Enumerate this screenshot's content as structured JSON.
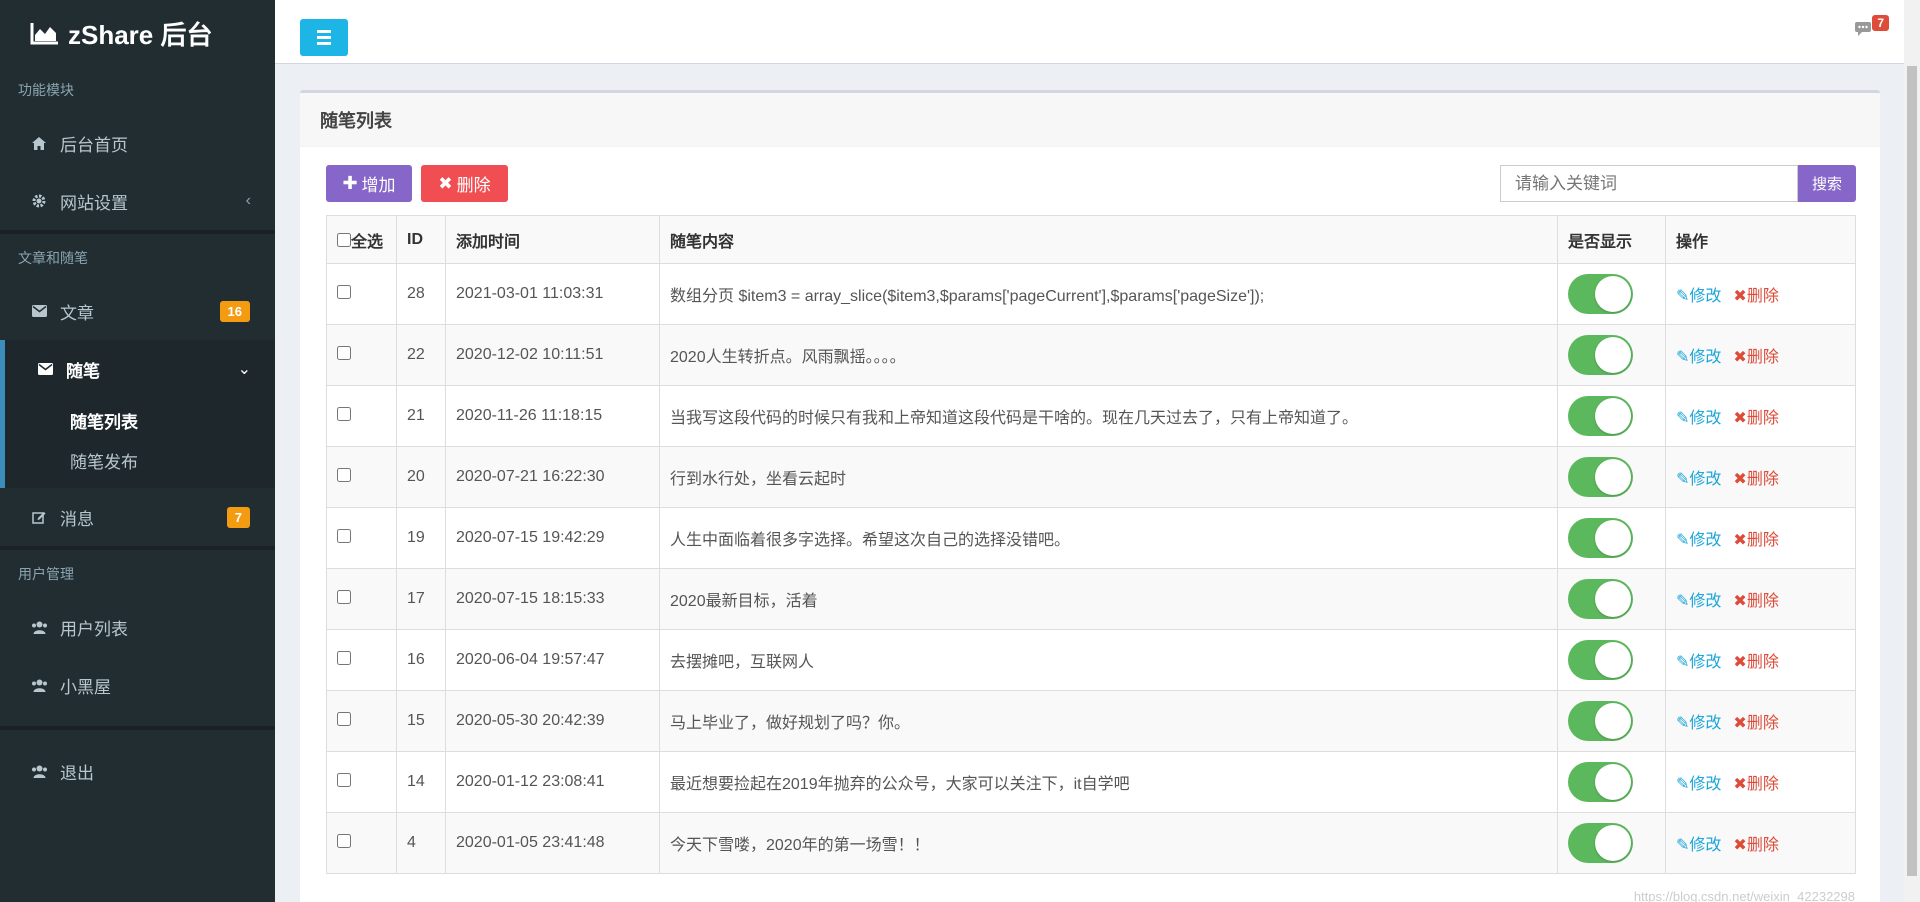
{
  "app": {
    "logo_text": "zShare 后台"
  },
  "sidebar": {
    "sections": [
      {
        "label": "功能模块"
      },
      {
        "label": "文章和随笔"
      },
      {
        "label": "用户管理"
      }
    ],
    "items": {
      "home": "后台首页",
      "settings": "网站设置",
      "articles": "文章",
      "articles_badge": "16",
      "notes": "随笔",
      "notes_list": "随笔列表",
      "notes_publish": "随笔发布",
      "messages": "消息",
      "messages_badge": "7",
      "users": "用户列表",
      "blackroom": "小黑屋",
      "logout": "退出"
    }
  },
  "header": {
    "message_count": "7"
  },
  "main": {
    "title": "随笔列表",
    "add_label": "增加",
    "delete_label": "删除",
    "search_placeholder": "请输入关键词",
    "search_label": "搜索",
    "columns": {
      "select_all": "全选",
      "id": "ID",
      "time": "添加时间",
      "content": "随笔内容",
      "visible": "是否显示",
      "actions": "操作"
    },
    "edit_label": "修改",
    "row_delete_label": "删除",
    "rows": [
      {
        "id": "28",
        "time": "2021-03-01 11:03:31",
        "content": "数组分页 $item3 = array_slice($item3,$params['pageCurrent'],$params['pageSize']);",
        "visible": true
      },
      {
        "id": "22",
        "time": "2020-12-02 10:11:51",
        "content": "2020人生转折点。风雨飘摇。。。。",
        "visible": true
      },
      {
        "id": "21",
        "time": "2020-11-26 11:18:15",
        "content": "当我写这段代码的时候只有我和上帝知道这段代码是干啥的。现在几天过去了，只有上帝知道了。",
        "visible": true
      },
      {
        "id": "20",
        "time": "2020-07-21 16:22:30",
        "content": "行到水行处，坐看云起时",
        "visible": true
      },
      {
        "id": "19",
        "time": "2020-07-15 19:42:29",
        "content": "人生中面临着很多字选择。希望这次自己的选择没错吧。",
        "visible": true
      },
      {
        "id": "17",
        "time": "2020-07-15 18:15:33",
        "content": "2020最新目标，活着",
        "visible": true
      },
      {
        "id": "16",
        "time": "2020-06-04 19:57:47",
        "content": "去摆摊吧，互联网人",
        "visible": true
      },
      {
        "id": "15",
        "time": "2020-05-30 20:42:39",
        "content": "马上毕业了，做好规划了吗？你。",
        "visible": true
      },
      {
        "id": "14",
        "time": "2020-01-12 23:08:41",
        "content": "最近想要捡起在2019年抛弃的公众号，大家可以关注下，it自学吧",
        "visible": true
      },
      {
        "id": "4",
        "time": "2020-01-05 23:41:48",
        "content": "今天下雪喽，2020年的第一场雪！！",
        "visible": true
      }
    ]
  },
  "watermark": "https://blog.csdn.net/weixin_42232298",
  "colors": {
    "sidebar_bg": "#222d32",
    "accent_purple": "#8667c9",
    "danger": "#f04e52",
    "toggle_on": "#5cb85c",
    "badge_orange": "#f39c12"
  }
}
